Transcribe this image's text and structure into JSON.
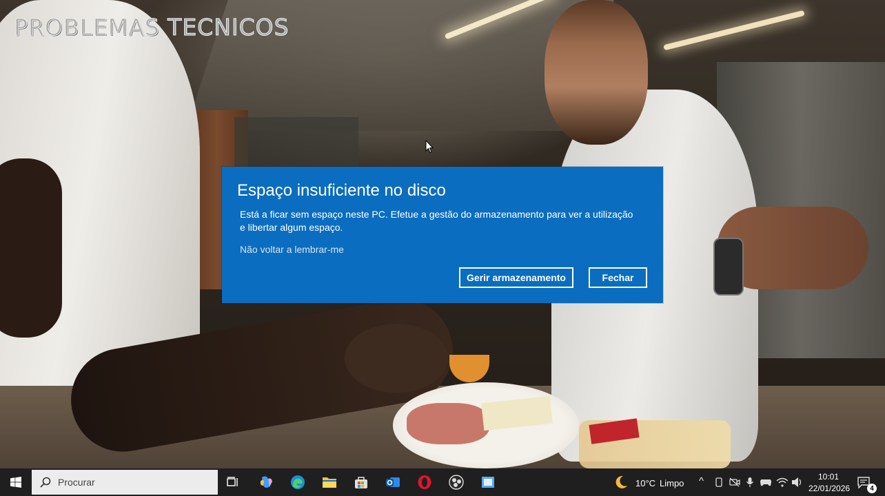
{
  "watermark": "PROBLEMAS TECNICOS",
  "dialog": {
    "title": "Espaço insuficiente no disco",
    "message": "Está a ficar sem espaço neste PC. Efetue a gestão do armazenamento para ver a utilização e libertar algum espaço.",
    "dismiss_link": "Não voltar a lembrar-me",
    "primary_button": "Gerir armazenamento",
    "secondary_button": "Fechar",
    "background_color": "#0b6dbf"
  },
  "taskbar": {
    "search_placeholder": "Procurar",
    "apps": [
      "task-view-icon",
      "copilot-icon",
      "edge-icon",
      "file-explorer-icon",
      "store-icon",
      "outlook-icon",
      "opera-icon",
      "obs-icon",
      "app-window-icon"
    ],
    "weather": {
      "temp": "10°C",
      "condition": "Limpo"
    },
    "time": "10:01",
    "date": "22/01/2026",
    "notification_count": "4"
  }
}
